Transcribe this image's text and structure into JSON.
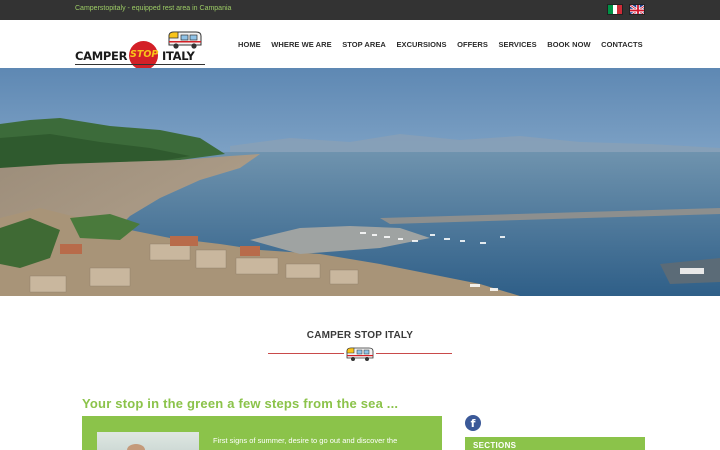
{
  "topbar": {
    "tagline": "Camperstopitaly - equipped rest area in Campania",
    "languages": [
      {
        "name": "Italian",
        "icon": "italy-flag-icon"
      },
      {
        "name": "English",
        "icon": "uk-flag-icon"
      }
    ]
  },
  "logo": {
    "word1": "CAMPER",
    "word2": "STOP",
    "word3": "ITALY",
    "colors": {
      "circle": "#d32027",
      "stop": "#f9c41a"
    }
  },
  "nav": {
    "items": [
      {
        "label": "HOME"
      },
      {
        "label": "WHERE WE ARE"
      },
      {
        "label": "STOP AREA"
      },
      {
        "label": "EXCURSIONS"
      },
      {
        "label": "OFFERS"
      },
      {
        "label": "SERVICES"
      },
      {
        "label": "BOOK NOW"
      },
      {
        "label": "CONTACTS"
      }
    ]
  },
  "main": {
    "section_title": "CAMPER STOP ITALY",
    "headline": "Your stop in the green a few steps from the sea ...",
    "intro_text": "First signs of summer, desire to go out and discover the",
    "accent_color": "#8bc34a"
  },
  "sidebar": {
    "social_icon": "facebook-icon",
    "sections_title": "SECTIONS"
  }
}
